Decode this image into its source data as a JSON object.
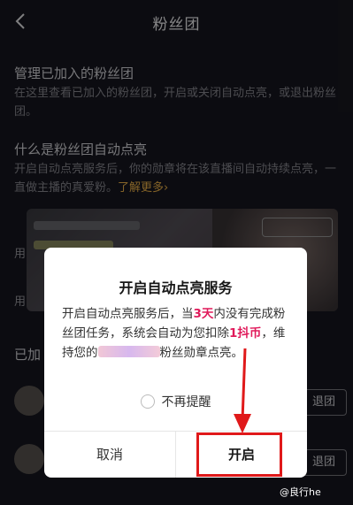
{
  "header": {
    "title": "粉丝团",
    "back_icon": "chevron-left-icon"
  },
  "sections": {
    "manage": {
      "title": "管理已加入的粉丝团",
      "desc": "在这里查看已加入的粉丝团，开启或关闭自动点亮，或退出粉丝团。"
    },
    "auto_light": {
      "title": "什么是粉丝团自动点亮",
      "desc": "开启自动点亮服务后，你的勋章将在该直播间自动持续点亮，一直做主播的真爱粉。",
      "learn_more": "了解更多›"
    }
  },
  "background_fragments": {
    "row1": "用",
    "row2": "用",
    "added_label": "已加",
    "quit_button_1": "退团",
    "quit_button_2": "退团"
  },
  "dialog": {
    "title": "开启自动点亮服务",
    "body_part1": "开启自动点亮服务后，当",
    "body_days": "3天",
    "body_part2": "内没有完成粉丝团任务，系统会自动为您扣除",
    "body_coin": "1抖币",
    "body_part3": "，维持您的",
    "body_part4": "粉丝勋章点亮。",
    "no_remind": "不再提醒",
    "cancel": "取消",
    "confirm": "开启"
  },
  "colors": {
    "background": "#17171f",
    "highlight": "#e0195a",
    "link": "#f2b64a",
    "annotation": "#e0191a"
  },
  "watermark": "@良行he"
}
